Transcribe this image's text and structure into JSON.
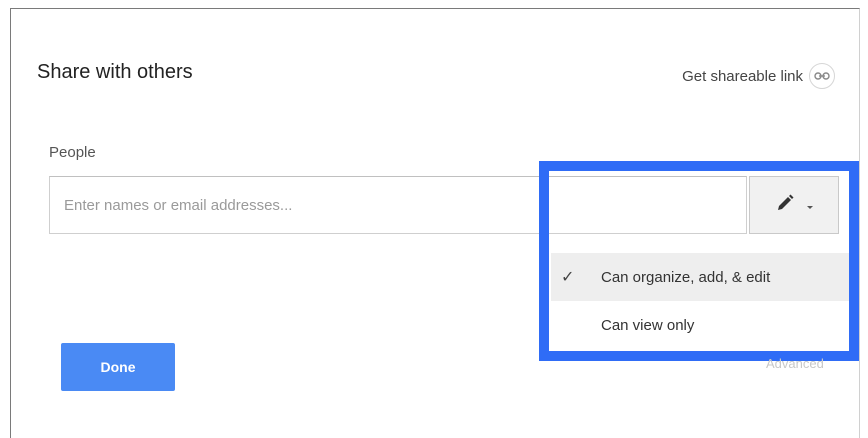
{
  "dialog": {
    "title": "Share with others",
    "share_link_label": "Get shareable link",
    "share_link_icon": "link-icon",
    "people_label": "People",
    "people_input": {
      "value": "",
      "placeholder": "Enter names or email addresses..."
    },
    "permission_button": {
      "icon": "pencil-icon",
      "caret_icon": "caret-down-icon"
    },
    "permission_menu": {
      "items": [
        {
          "label": "Can organize, add, & edit",
          "selected": true
        },
        {
          "label": "Can view only",
          "selected": false
        }
      ],
      "check_mark": "✓"
    },
    "faded_text": "Advanced",
    "done_label": "Done"
  },
  "colors": {
    "highlight": "#2f6cf6",
    "done_button": "#4a8af4",
    "selected_item_bg": "#eeeeee"
  }
}
